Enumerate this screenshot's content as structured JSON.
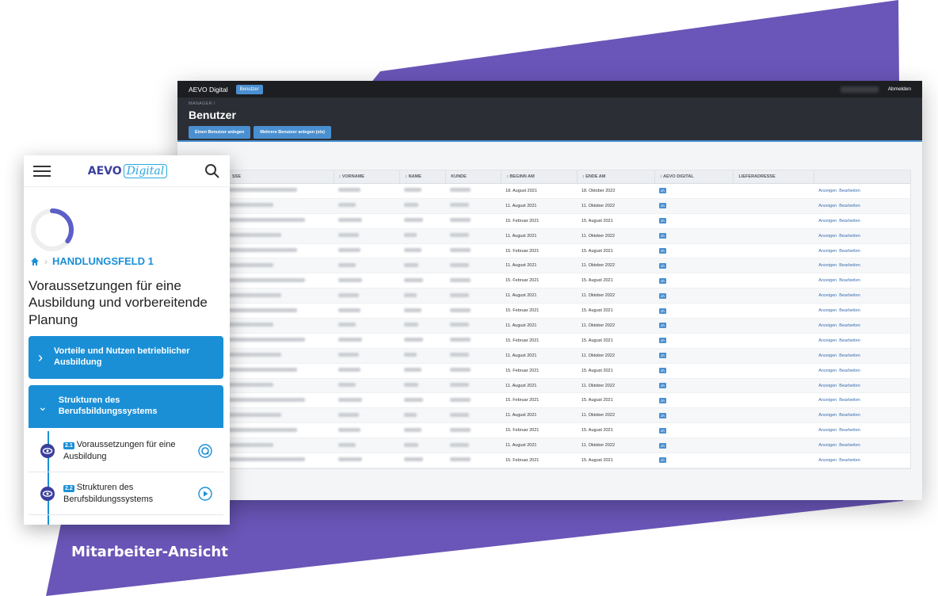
{
  "colors": {
    "purple": "#6a56b8",
    "accent_blue": "#1a8fd6",
    "desktop_accent": "#4a90d0",
    "dark_header": "#2b2e35"
  },
  "caption": "Mitarbeiter-Ansicht",
  "desktop": {
    "brand": "AEVO Digital",
    "nav_tab": "Benutzer",
    "logout": "Abmelden",
    "breadcrumb": "MANAGER /",
    "page_title": "Benutzer",
    "actions": [
      "Einen Benutzer anlegen",
      "Mehrere Benutzer anlegen (xls)"
    ],
    "table": {
      "headers": [
        "E-MAIL-ADRESSE",
        "VORNAME",
        "NAME",
        "KUNDE",
        "BEGINN AM",
        "ENDE AM",
        "AEVO DIGITAL",
        "LIEFERADRESSE",
        ""
      ],
      "visible_header_fragment": "SSE",
      "badge": "JA",
      "link_show": "Anzeigen",
      "link_edit": "Bearbeiten",
      "rows": [
        {
          "beginn": "18. August 2021",
          "ende": "18. Oktober 2022"
        },
        {
          "beginn": "11. August 2021",
          "ende": "11. Oktober 2022"
        },
        {
          "beginn": "15. Februar 2021",
          "ende": "15. August 2021"
        },
        {
          "beginn": "11. August 2021",
          "ende": "11. Oktober 2022"
        },
        {
          "beginn": "15. Februar 2021",
          "ende": "15. August 2021"
        },
        {
          "beginn": "11. August 2021",
          "ende": "11. Oktober 2022"
        },
        {
          "beginn": "15. Februar 2021",
          "ende": "15. August 2021"
        },
        {
          "beginn": "11. August 2021",
          "ende": "11. Oktober 2022"
        },
        {
          "beginn": "15. Februar 2021",
          "ende": "15. August 2021"
        },
        {
          "beginn": "11. August 2021",
          "ende": "11. Oktober 2022"
        },
        {
          "beginn": "15. Februar 2021",
          "ende": "15. August 2021"
        },
        {
          "beginn": "11. August 2021",
          "ende": "11. Oktober 2022"
        },
        {
          "beginn": "15. Februar 2021",
          "ende": "15. August 2021"
        },
        {
          "beginn": "11. August 2021",
          "ende": "11. Oktober 2022"
        },
        {
          "beginn": "15. Februar 2021",
          "ende": "15. August 2021"
        },
        {
          "beginn": "11. August 2021",
          "ende": "11. Oktober 2022"
        },
        {
          "beginn": "15. Februar 2021",
          "ende": "15. August 2021"
        },
        {
          "beginn": "11. August 2021",
          "ende": "11. Oktober 2022"
        },
        {
          "beginn": "15. Februar 2021",
          "ende": "15. August 2021"
        }
      ]
    }
  },
  "mobile": {
    "logo_part1": "AEVO",
    "logo_part2": "Digital",
    "progress_fraction": 0.35,
    "breadcrumb": "HANDLUNGSFELD 1",
    "title": "Voraussetzungen für eine Ausbildung und vorbereitende Planung",
    "accordions": [
      {
        "label": "Vorteile und Nutzen betrieblicher Ausbildung",
        "expanded": false
      },
      {
        "label": "Strukturen des Berufsbildungssystems",
        "expanded": true
      }
    ],
    "lessons": [
      {
        "number": "2.1",
        "label": "Voraussetzungen für eine Ausbildung",
        "icon": "quiz-icon"
      },
      {
        "number": "2.2",
        "label": "Strukturen des Berufsbildungssystems",
        "icon": "play-icon"
      }
    ]
  }
}
